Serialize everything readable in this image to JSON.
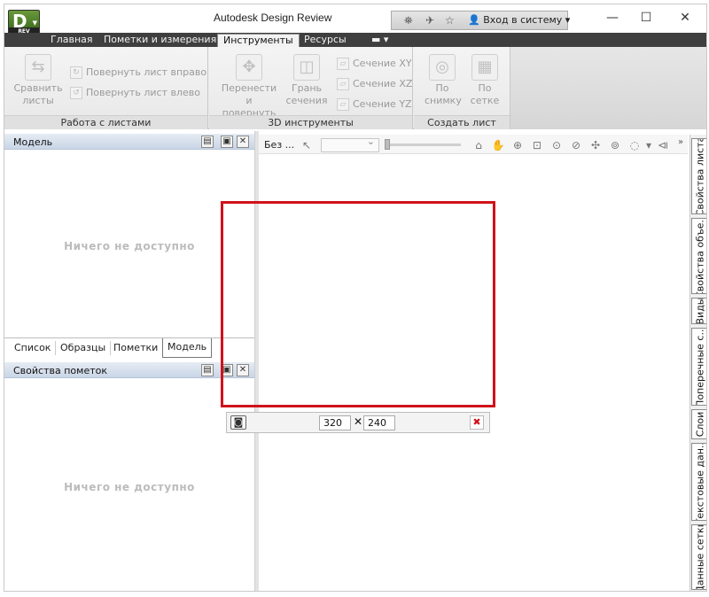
{
  "window": {
    "title": "Autodesk Design Review",
    "app_badge": "REV",
    "app_letter": "D",
    "sign_in": "Вход в систему",
    "controls": {
      "minimize": "—",
      "maximize": "☐",
      "close": "✕"
    }
  },
  "ribbon_tabs": [
    {
      "label": "Главная",
      "active": false
    },
    {
      "label": "Пометки и измерения",
      "active": false
    },
    {
      "label": "Инструменты",
      "active": true
    },
    {
      "label": "Ресурсы",
      "active": false
    }
  ],
  "ribbon": {
    "sheets_panel": {
      "title": "Работа с листами",
      "compare": "Сравнить\nлисты",
      "rotate_right": "Повернуть лист вправо",
      "rotate_left": "Повернуть лист влево"
    },
    "tools3d_panel": {
      "title": "3D инструменты",
      "move_rotate": "Перенести и\nповернуть",
      "section_face": "Грань\nсечения",
      "section_xy": "Сечение XY",
      "section_xz": "Сечение XZ",
      "section_yz": "Сечение YZ"
    },
    "create_sheet_panel": {
      "title": "Создать лист",
      "by_snapshot": "По\nснимку",
      "by_grid": "По\nсетке"
    }
  },
  "model_palette": {
    "title": "Модель",
    "empty": "Ничего не доступно"
  },
  "palette_tabs": [
    {
      "label": "Список",
      "active": false
    },
    {
      "label": "Образцы",
      "active": false
    },
    {
      "label": "Пометки",
      "active": false
    },
    {
      "label": "Модель",
      "active": true
    }
  ],
  "markup_props_palette": {
    "title": "Свойства пометок",
    "empty": "Ничего не доступно"
  },
  "canvas_toolbar": {
    "view_label": "Без ..."
  },
  "capture": {
    "width": "320",
    "height": "240",
    "times": "✕"
  },
  "side_tabs": [
    "Свойства листа",
    "Свойства объе...",
    "Виды",
    "Поперечные с...",
    "Слои",
    "Текстовые дан...",
    "Данные сетки"
  ],
  "colors": {
    "capture_frame": "#d0121b",
    "tab_bar": "#3f3f3f",
    "palette_header": "#c9d5e6"
  }
}
